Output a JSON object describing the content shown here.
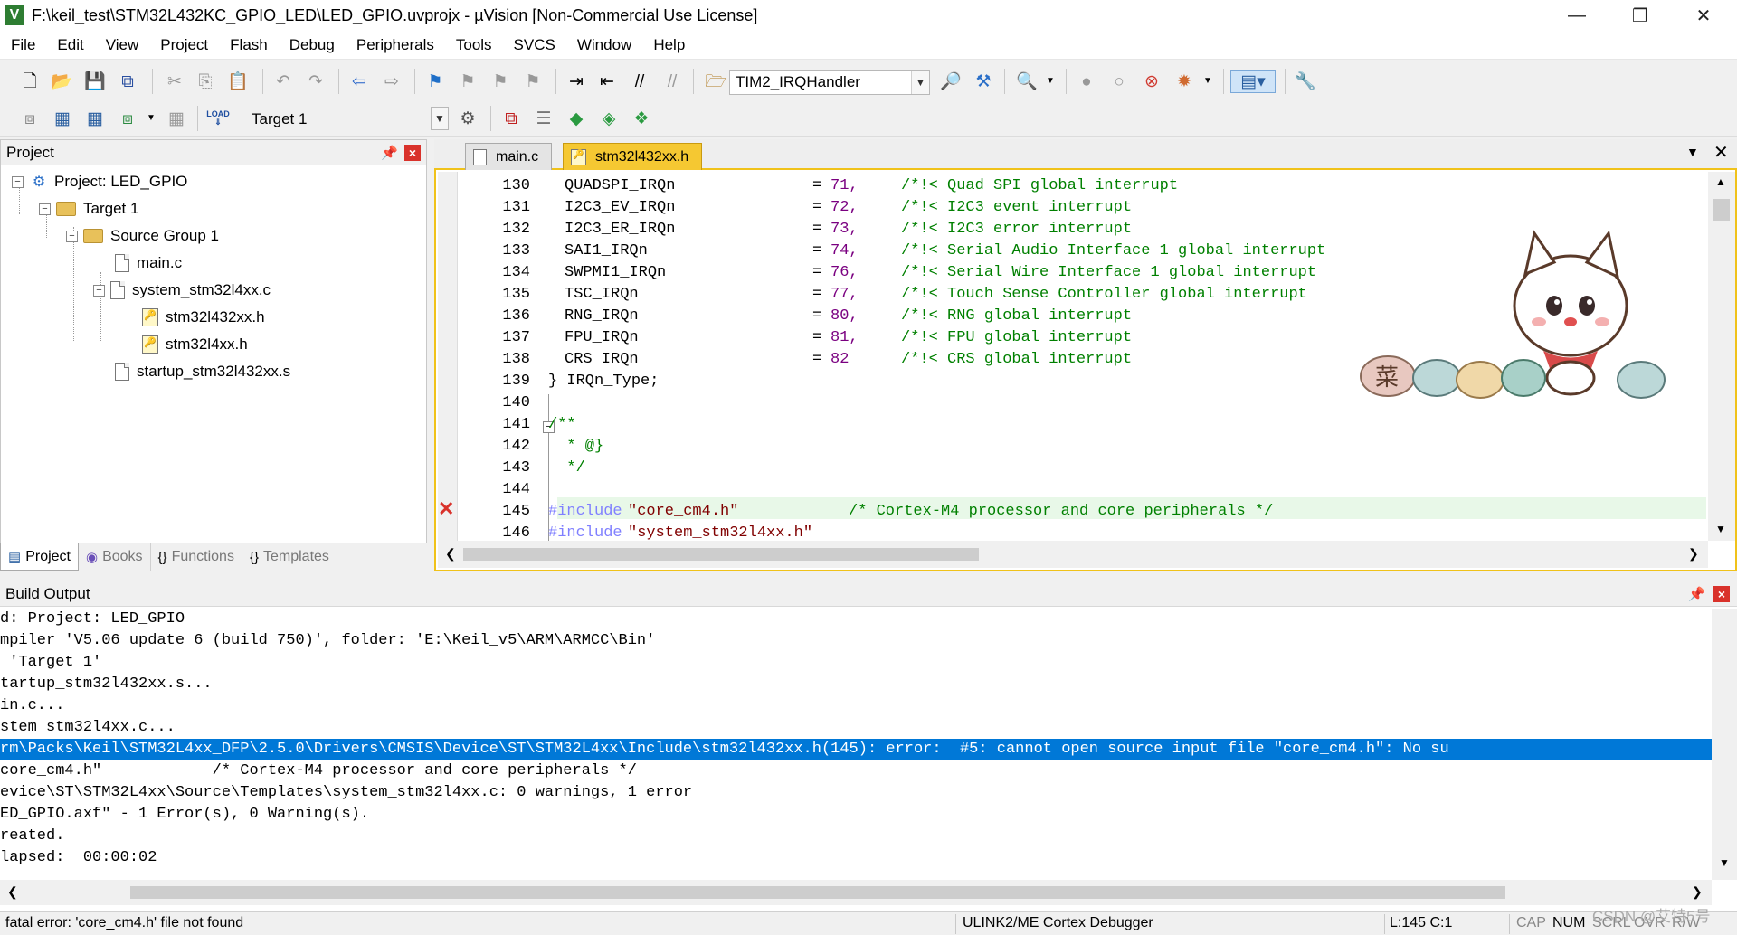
{
  "window": {
    "title": "F:\\keil_test\\STM32L432KC_GPIO_LED\\LED_GPIO.uvprojx - µVision  [Non-Commercial Use License]",
    "app_icon": "V"
  },
  "menu": [
    "File",
    "Edit",
    "View",
    "Project",
    "Flash",
    "Debug",
    "Peripherals",
    "Tools",
    "SVCS",
    "Window",
    "Help"
  ],
  "toolbar1": {
    "function_combo": "TIM2_IRQHandler"
  },
  "toolbar2": {
    "target_combo": "Target 1",
    "load_label": "LOAD"
  },
  "project_pane": {
    "title": "Project",
    "tree": {
      "project": "Project: LED_GPIO",
      "target": "Target 1",
      "group": "Source Group 1",
      "main_c": "main.c",
      "system_c": "system_stm32l4xx.c",
      "h1": "stm32l432xx.h",
      "h2": "stm32l4xx.h",
      "startup": "startup_stm32l432xx.s"
    },
    "tabs": [
      {
        "label": "Project"
      },
      {
        "label": "Books"
      },
      {
        "label": "Functions"
      },
      {
        "label": "Templates"
      }
    ]
  },
  "editor": {
    "tabs": [
      {
        "label": "main.c"
      },
      {
        "label": "stm32l432xx.h"
      }
    ],
    "lines": [
      {
        "n": "130",
        "name": "QUADSPI_IRQn",
        "val": "71,",
        "cmt": "/*!< Quad SPI global interrupt"
      },
      {
        "n": "131",
        "name": "I2C3_EV_IRQn",
        "val": "72,",
        "cmt": "/*!< I2C3 event interrupt"
      },
      {
        "n": "132",
        "name": "I2C3_ER_IRQn",
        "val": "73,",
        "cmt": "/*!< I2C3 error interrupt"
      },
      {
        "n": "133",
        "name": "SAI1_IRQn",
        "val": "74,",
        "cmt": "/*!< Serial Audio Interface 1 global interrupt"
      },
      {
        "n": "134",
        "name": "SWPMI1_IRQn",
        "val": "76,",
        "cmt": "/*!< Serial Wire Interface 1 global interrupt"
      },
      {
        "n": "135",
        "name": "TSC_IRQn",
        "val": "77,",
        "cmt": "/*!< Touch Sense Controller global interrupt"
      },
      {
        "n": "136",
        "name": "RNG_IRQn",
        "val": "80,",
        "cmt": "/*!< RNG global interrupt"
      },
      {
        "n": "137",
        "name": "FPU_IRQn",
        "val": "81,",
        "cmt": "/*!< FPU global interrupt"
      },
      {
        "n": "138",
        "name": "CRS_IRQn",
        "val": "82",
        "cmt": "/*!< CRS global interrupt"
      }
    ],
    "line139": {
      "n": "139",
      "text": "} IRQn_Type;"
    },
    "line140": {
      "n": "140"
    },
    "line141": {
      "n": "141",
      "text": "/**"
    },
    "line142": {
      "n": "142",
      "text": "  * @}"
    },
    "line143": {
      "n": "143",
      "text": "  */"
    },
    "line144": {
      "n": "144"
    },
    "line145": {
      "n": "145",
      "pp": "#include",
      "str": "\"core_cm4.h\"",
      "cmt": "/* Cortex-M4 processor and core peripherals */"
    },
    "line146": {
      "n": "146",
      "pp": "#include",
      "str": "\"system_stm32l4xx.h\""
    },
    "sticker_text": "菜"
  },
  "build_output": {
    "title": "Build Output",
    "lines": [
      {
        "text": "d: Project: LED_GPIO",
        "selected": false
      },
      {
        "text": "mpiler 'V5.06 update 6 (build 750)', folder: 'E:\\Keil_v5\\ARM\\ARMCC\\Bin'",
        "selected": false
      },
      {
        "text": " 'Target 1'",
        "selected": false
      },
      {
        "text": "tartup_stm32l432xx.s...",
        "selected": false
      },
      {
        "text": "in.c...",
        "selected": false
      },
      {
        "text": "stem_stm32l4xx.c...",
        "selected": false
      },
      {
        "text": "rm\\Packs\\Keil\\STM32L4xx_DFP\\2.5.0\\Drivers\\CMSIS\\Device\\ST\\STM32L4xx\\Include\\stm32l432xx.h(145): error:  #5: cannot open source input file \"core_cm4.h\": No su",
        "selected": true
      },
      {
        "text": "core_cm4.h\"            /* Cortex-M4 processor and core peripherals */",
        "selected": false
      },
      {
        "text": "evice\\ST\\STM32L4xx\\Source\\Templates\\system_stm32l4xx.c: 0 warnings, 1 error",
        "selected": false
      },
      {
        "text": "ED_GPIO.axf\" - 1 Error(s), 0 Warning(s).",
        "selected": false
      },
      {
        "text": "reated.",
        "selected": false
      },
      {
        "text": "lapsed:  00:00:02",
        "selected": false
      }
    ]
  },
  "statusbar": {
    "message": "fatal error: 'core_cm4.h' file not found",
    "debugger": "ULINK2/ME Cortex Debugger",
    "position": "L:145 C:1",
    "cap": "CAP",
    "num": "NUM",
    "scrl": "SCRL",
    "ovr": "OVR",
    "rw": "R/W",
    "watermark": "CSDN @艾特5号"
  },
  "colors": {
    "accent_tab": "#f5c832",
    "selection": "#0078d7",
    "current_line": "#e8f8e8",
    "error_mark": "#d9322b"
  }
}
